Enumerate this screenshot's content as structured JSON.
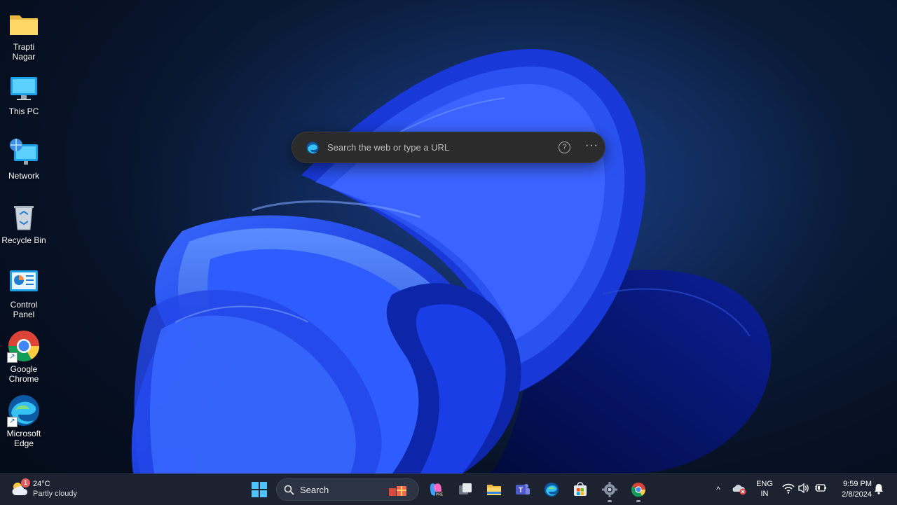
{
  "desktop": {
    "icons": [
      {
        "label": "Trapti Nagar",
        "icon": "folder-icon"
      },
      {
        "label": "This PC",
        "icon": "monitor-icon"
      },
      {
        "label": "Network",
        "icon": "network-icon"
      },
      {
        "label": "Recycle Bin",
        "icon": "recycle-bin-icon"
      },
      {
        "label": "Control Panel",
        "icon": "control-panel-icon"
      },
      {
        "label": "Google Chrome",
        "icon": "chrome-icon"
      },
      {
        "label": "Microsoft Edge",
        "icon": "edge-icon"
      }
    ]
  },
  "edge_search": {
    "placeholder": "Search the web or type a URL",
    "help_glyph": "?",
    "more_glyph": "···"
  },
  "taskbar": {
    "weather": {
      "badge": "1",
      "temp": "24°C",
      "condition": "Partly cloudy"
    },
    "search_label": "Search",
    "pinned": [
      "start-icon",
      "copilot-icon",
      "task-view-icon",
      "file-explorer-icon",
      "teams-icon",
      "edge-icon",
      "store-icon",
      "settings-icon",
      "chrome-icon"
    ],
    "tray": {
      "chevron": "^",
      "lang_line1": "ENG",
      "lang_line2": "IN",
      "time": "9:59 PM",
      "date": "2/8/2024"
    }
  },
  "colors": {
    "taskbar_bg": "#1c2230",
    "bloom_blue": "#1f4dff",
    "bar_bg": "#2b2b2b"
  }
}
